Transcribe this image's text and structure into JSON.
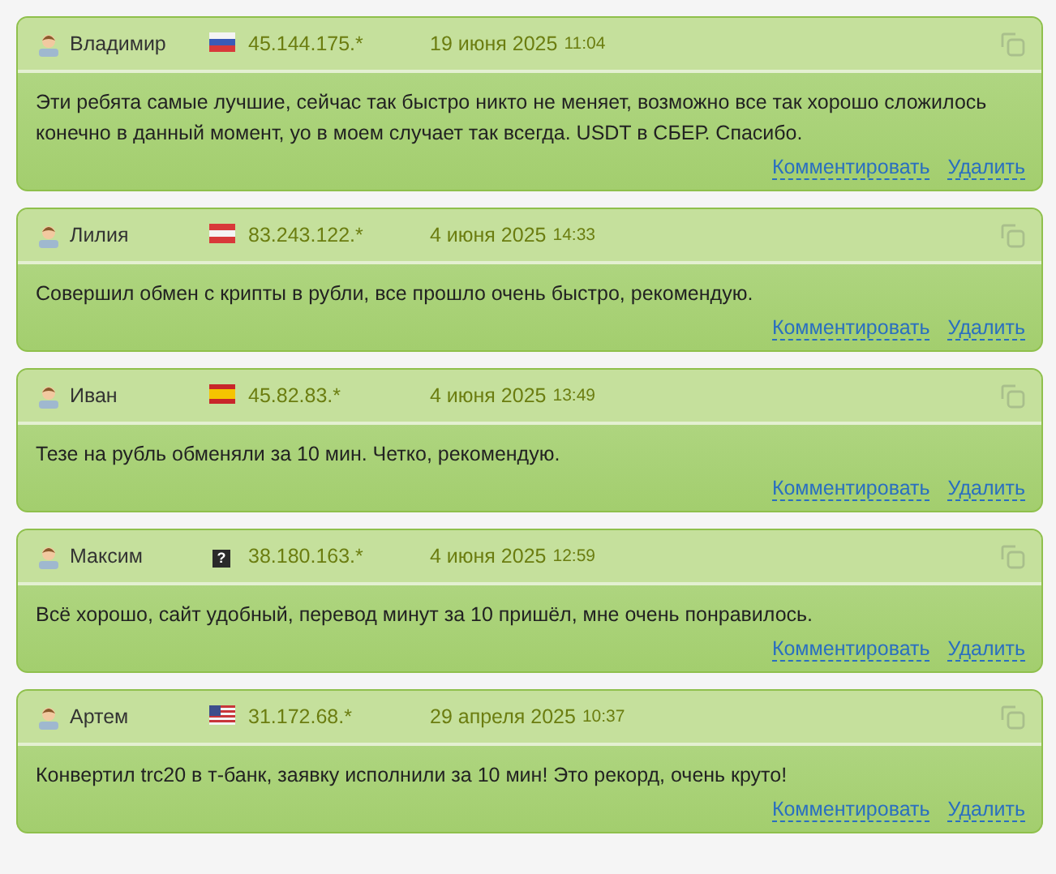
{
  "reviews": [
    {
      "author": "Владимир",
      "flag": {
        "kind": "ru"
      },
      "ip": "45.144.175.*",
      "date": "19 июня 2025",
      "time": "11:04",
      "text": "Эти ребята самые лучшие, сейчас так быстро никто не меняет, возможно все так хорошо сложилось конечно в данный момент, уо в моем случает так всегда. USDT в СБЕР. Спасибо.",
      "actions": [
        "Комментировать",
        "Удалить"
      ]
    },
    {
      "author": "Лилия",
      "flag": {
        "kind": "at"
      },
      "ip": "83.243.122.*",
      "date": "4 июня 2025",
      "time": "14:33",
      "text": "Совершил обмен с крипты в рубли, все прошло очень быстро, рекомендую.",
      "actions": [
        "Комментировать",
        "Удалить"
      ]
    },
    {
      "author": "Иван",
      "flag": {
        "kind": "es"
      },
      "ip": "45.82.83.*",
      "date": "4 июня 2025",
      "time": "13:49",
      "text": "Тезе на рубль обменяли за 10 мин. Четко, рекомендую.",
      "actions": [
        "Комментировать",
        "Удалить"
      ]
    },
    {
      "author": "Максим",
      "flag": {
        "kind": "unknown",
        "text": "?"
      },
      "ip": "38.180.163.*",
      "date": "4 июня 2025",
      "time": "12:59",
      "text": "Всё хорошо, сайт удобный, перевод минут за 10 пришёл, мне очень понравилось.",
      "actions": [
        "Комментировать",
        "Удалить"
      ]
    },
    {
      "author": "Артем",
      "flag": {
        "kind": "us"
      },
      "ip": "31.172.68.*",
      "date": "29 апреля 2025",
      "time": "10:37",
      "text": "Конвертил trc20 в т-банк, заявку исполнили за 10 мин! Это рекорд, очень круто!",
      "actions": [
        "Комментировать",
        "Удалить"
      ]
    }
  ]
}
